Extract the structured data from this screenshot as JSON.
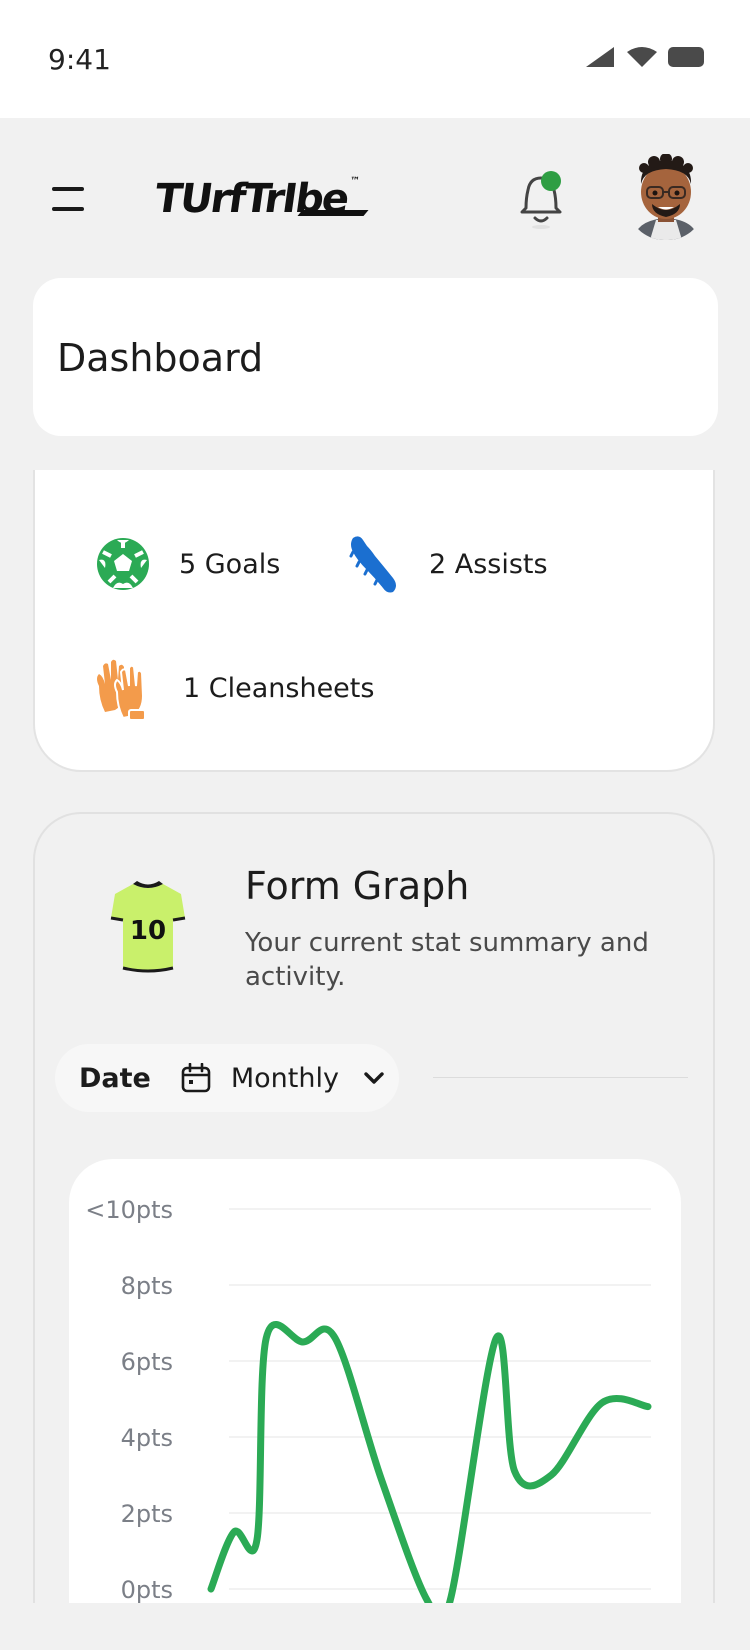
{
  "status_bar": {
    "time": "9:41"
  },
  "header": {
    "logo_text": "TUrfTrIbe",
    "logo_mark": "™"
  },
  "dashboard": {
    "title": "Dashboard"
  },
  "stats": {
    "goals": "5 Goals",
    "assists": "2 Assists",
    "cleansheets": "1 Cleansheets"
  },
  "form_graph": {
    "title": "Form Graph",
    "subtitle": "Your current stat summary and activity.",
    "jersey_number": "10",
    "filter": {
      "label": "Date",
      "value": "Monthly"
    }
  },
  "colors": {
    "accent_green": "#2baa55",
    "notification_dot": "#2e9e43",
    "assist_blue": "#1b6fd0",
    "glove_orange": "#f39b4b",
    "jersey_lime": "#c9f06b"
  },
  "chart_data": {
    "type": "line",
    "y_tick_labels": [
      "<10pts",
      "8pts",
      "6pts",
      "4pts",
      "2pts",
      "0pts"
    ],
    "ylim": [
      0,
      10
    ],
    "grid": true,
    "series": [
      {
        "color": "#2baa55",
        "points": [
          [
            0,
            0.0
          ],
          [
            0.05,
            1.5
          ],
          [
            0.1,
            1.3
          ],
          [
            0.12,
            6.6
          ],
          [
            0.2,
            6.5
          ],
          [
            0.27,
            6.6
          ],
          [
            0.37,
            2.9
          ],
          [
            0.47,
            -0.3
          ],
          [
            0.52,
            -0.3
          ],
          [
            0.62,
            6.6
          ],
          [
            0.66,
            3.1
          ],
          [
            0.74,
            3.0
          ],
          [
            0.85,
            4.9
          ],
          [
            0.95,
            4.8
          ]
        ]
      }
    ]
  }
}
